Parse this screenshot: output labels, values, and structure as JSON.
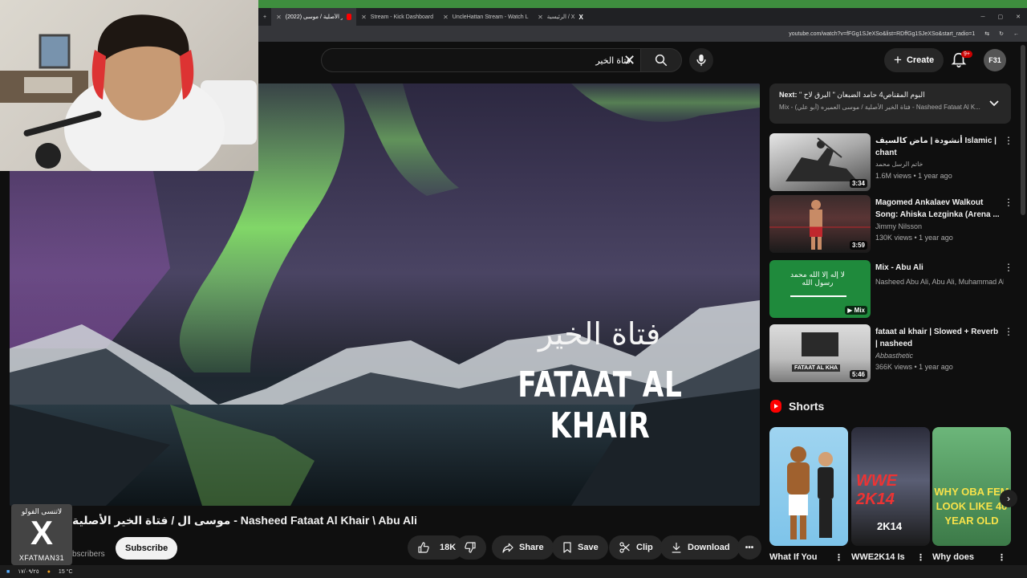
{
  "browser": {
    "tabs": [
      {
        "label": "فتاة الخير الأصلية / موسى (2022)",
        "icon": "youtube-icon",
        "color": "#ff0000"
      },
      {
        "label": "Stream - Kick Dashboard",
        "icon": "kick-icon",
        "color": "#53fc18"
      },
      {
        "label": "UncleHattan Stream - Watch L",
        "icon": "kick-icon",
        "color": "#53fc18"
      },
      {
        "label": "الرئيسية / X",
        "icon": "x-icon",
        "color": "#ffffff"
      }
    ],
    "new_tab": "+",
    "url": "youtube.com/watch?v=fFGg1SJeXSo&list=RDffGg1SJeXSo&start_radio=1"
  },
  "header": {
    "search_query": "فتاة الخير",
    "create_label": "Create",
    "notif_count": "9+",
    "avatar_label": "F31"
  },
  "video": {
    "overlay_arabic": "فتاة الخير",
    "overlay_english": "FATAAT AL KHAIR",
    "title": "موسى ال / فتاة الخير الأصلية - Nasheed Fataat Al Khair \\ Abu Ali",
    "subs_text": "bscribers",
    "subscribe_label": "Subscribe",
    "likes": "18K",
    "share_label": "Share",
    "save_label": "Save",
    "clip_label": "Clip",
    "download_label": "Download",
    "more_label": "•••"
  },
  "streamer": {
    "badge_top": "لاتنسى الفولو",
    "badge_x": "X",
    "badge_bottom": "XFATMAN31"
  },
  "sidebar": {
    "next_prefix": "Next:",
    "next_title": "\" البوم المقناص4 حامد الضبعان \" البرق لاح",
    "next_sub": "Mix - فتاة الخير الأصلية / موسى العميره (أبو علي) - Nasheed Fataat Al K...",
    "recs": [
      {
        "title": "أنشودة | ماض كالسيف Islamic | chant",
        "channel": "خاتم الرسل محمد",
        "meta": "1.6M views • 1 year ago",
        "duration": "3:34"
      },
      {
        "title": "Magomed Ankalaev Walkout Song: Ahiska Lezginka (Arena ...",
        "channel": "Jimmy Nilsson",
        "meta": "130K views • 1 year ago",
        "duration": "3:59"
      },
      {
        "title": "Mix - Abu Ali",
        "channel": "Nasheed Abu Ali, Abu Ali, Muhammad Al ...",
        "meta": "",
        "duration": "Mix"
      },
      {
        "title": "fataat al khair | Slowed + Reverb | nasheed",
        "channel": "Abbasthetic",
        "meta": "366K views • 1 year ago",
        "duration": "5:46"
      }
    ],
    "shorts_label": "Shorts",
    "shorts": [
      {
        "title": "What If You"
      },
      {
        "title": "WWE2K14 Is"
      },
      {
        "title": "Why does"
      }
    ],
    "short_thumbs": [
      "WWE 2K14",
      "2K14",
      "WHY OBA FEM LOOK LIKE 40 YEAR OLD"
    ],
    "rec3_thumb_text": "لا إله إلا الله محمد رسول الله",
    "rec4_thumb_text": "FATAAT AL KHA"
  },
  "taskbar": {
    "date": "١٧/٠٩/٢٥",
    "temp": "15 °C"
  },
  "colors": {
    "bg": "#0f0f0f",
    "accent_red": "#ff0000",
    "surface": "#272727"
  }
}
